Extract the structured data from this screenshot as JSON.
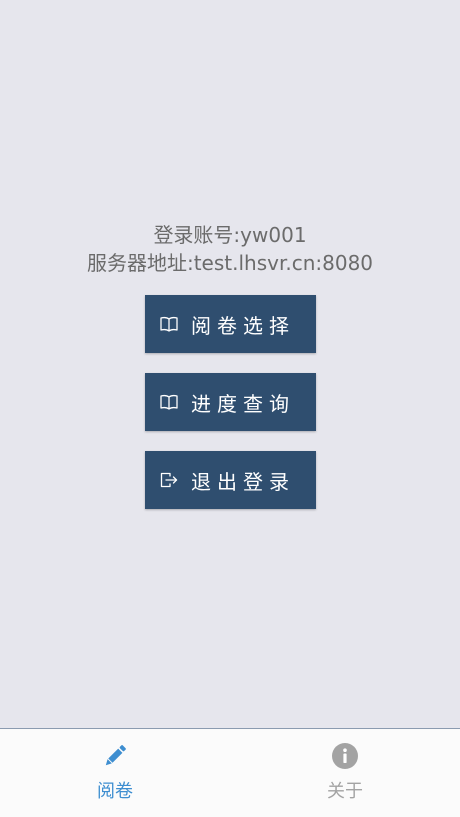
{
  "account": {
    "label": "登录账号:yw001",
    "server": "服务器地址:test.lhsvr.cn:8080"
  },
  "actions": [
    {
      "label": "阅卷选择",
      "icon": "book-icon"
    },
    {
      "label": "进度查询",
      "icon": "book-icon"
    },
    {
      "label": "退出登录",
      "icon": "logout-icon"
    }
  ],
  "tabs": [
    {
      "label": "阅卷",
      "icon": "pencil-icon",
      "active": true
    },
    {
      "label": "关于",
      "icon": "info-icon",
      "active": false
    }
  ],
  "colors": {
    "background": "#e6e6ed",
    "button": "#2f4e6f",
    "tab_active": "#3e8ed0",
    "tab_inactive": "#a3a3a3"
  }
}
